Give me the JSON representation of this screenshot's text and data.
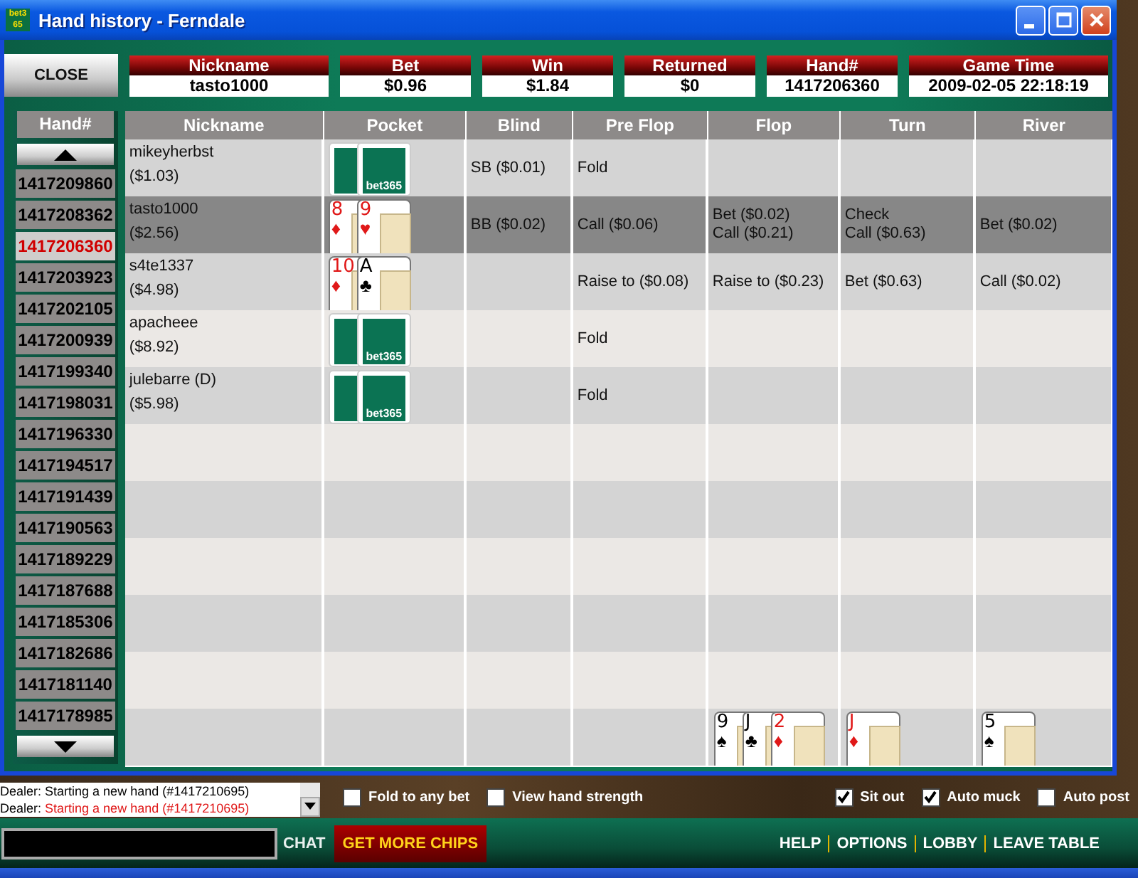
{
  "window": {
    "logo": "bet365",
    "title": "Hand history - Ferndale"
  },
  "close_button": "CLOSE",
  "summary": [
    {
      "label": "Nickname",
      "value": "tasto1000"
    },
    {
      "label": "Bet",
      "value": "$0.96"
    },
    {
      "label": "Win",
      "value": "$1.84"
    },
    {
      "label": "Returned",
      "value": "$0"
    },
    {
      "label": "Hand#",
      "value": "1417206360"
    },
    {
      "label": "Game Time",
      "value": "2009-02-05 22:18:19"
    }
  ],
  "hand_list": {
    "header": "Hand#",
    "items": [
      {
        "label": "1417209860",
        "selected": false
      },
      {
        "label": "1417208362",
        "selected": false
      },
      {
        "label": "1417206360",
        "selected": true
      },
      {
        "label": "1417203923",
        "selected": false
      },
      {
        "label": "1417202105",
        "selected": false
      },
      {
        "label": "1417200939",
        "selected": false
      },
      {
        "label": "1417199340",
        "selected": false
      },
      {
        "label": "1417198031",
        "selected": false
      },
      {
        "label": "1417196330",
        "selected": false
      },
      {
        "label": "1417194517",
        "selected": false
      },
      {
        "label": "1417191439",
        "selected": false
      },
      {
        "label": "1417190563",
        "selected": false
      },
      {
        "label": "1417189229",
        "selected": false
      },
      {
        "label": "1417187688",
        "selected": false
      },
      {
        "label": "1417185306",
        "selected": false
      },
      {
        "label": "1417182686",
        "selected": false
      },
      {
        "label": "1417181140",
        "selected": false
      },
      {
        "label": "1417178985",
        "selected": false
      }
    ]
  },
  "table": {
    "columns": [
      "Nickname",
      "Pocket",
      "Blind",
      "Pre Flop",
      "Flop",
      "Turn",
      "River"
    ],
    "rows": [
      {
        "nickname": "mikeyherbst",
        "stack": "($1.03)",
        "hero": false,
        "pocket": {
          "kind": "back",
          "label": "bet365"
        },
        "blind": "SB ($0.01)",
        "pre_flop": [
          "Fold"
        ]
      },
      {
        "nickname": "tasto1000",
        "stack": "($2.56)",
        "hero": true,
        "pocket": {
          "kind": "face",
          "cards": [
            {
              "rank": "8",
              "suit": "♦",
              "color": "#e01818"
            },
            {
              "rank": "9",
              "suit": "♥",
              "color": "#e01818"
            }
          ]
        },
        "blind": "BB ($0.02)",
        "pre_flop": [
          "Call ($0.06)"
        ],
        "flop": [
          "Bet ($0.02)",
          "Call ($0.21)"
        ],
        "turn": [
          "Check",
          "Call ($0.63)"
        ],
        "river": [
          "Bet ($0.02)"
        ]
      },
      {
        "nickname": "s4te1337",
        "stack": "($4.98)",
        "hero": false,
        "pocket": {
          "kind": "face",
          "cards": [
            {
              "rank": "10",
              "suit": "♦",
              "color": "#e01818"
            },
            {
              "rank": "A",
              "suit": "♣",
              "color": "#000000"
            }
          ]
        },
        "pre_flop": [
          "Raise to ($0.08)"
        ],
        "flop": [
          "Raise to ($0.23)"
        ],
        "turn": [
          "Bet ($0.63)"
        ],
        "river": [
          "Call ($0.02)"
        ]
      },
      {
        "nickname": "apacheee",
        "stack": "($8.92)",
        "hero": false,
        "pocket": {
          "kind": "back",
          "label": "bet365"
        },
        "pre_flop": [
          "Fold"
        ]
      },
      {
        "nickname": "julebarre (D)",
        "stack": "($5.98)",
        "hero": false,
        "pocket": {
          "kind": "back",
          "label": "bet365"
        },
        "pre_flop": [
          "Fold"
        ]
      }
    ],
    "board": {
      "flop": [
        {
          "rank": "9",
          "suit": "♠",
          "color": "#000000"
        },
        {
          "rank": "J",
          "suit": "♣",
          "color": "#000000"
        },
        {
          "rank": "2",
          "suit": "♦",
          "color": "#e01818"
        }
      ],
      "turn": [
        {
          "rank": "J",
          "suit": "♦",
          "color": "#e01818"
        }
      ],
      "river": [
        {
          "rank": "5",
          "suit": "♠",
          "color": "#000000"
        }
      ]
    }
  },
  "chat": [
    {
      "speaker": "Dealer:",
      "text": "Starting a new hand (#1417210695)",
      "color": "#000000"
    },
    {
      "speaker": "Dealer:",
      "text": "Starting a new hand (#1417210695)",
      "color": "#e01818"
    }
  ],
  "options_left": [
    {
      "label": "Fold to any bet",
      "checked": false
    },
    {
      "label": "View hand strength",
      "checked": false
    }
  ],
  "options_right": [
    {
      "label": "Sit out",
      "checked": true
    },
    {
      "label": "Auto muck",
      "checked": true
    },
    {
      "label": "Auto post",
      "checked": false
    }
  ],
  "footer": {
    "chat_label": "CHAT",
    "chips_button": "GET MORE CHIPS",
    "links": [
      "HELP",
      "OPTIONS",
      "LOBBY",
      "LEAVE TABLE"
    ]
  }
}
